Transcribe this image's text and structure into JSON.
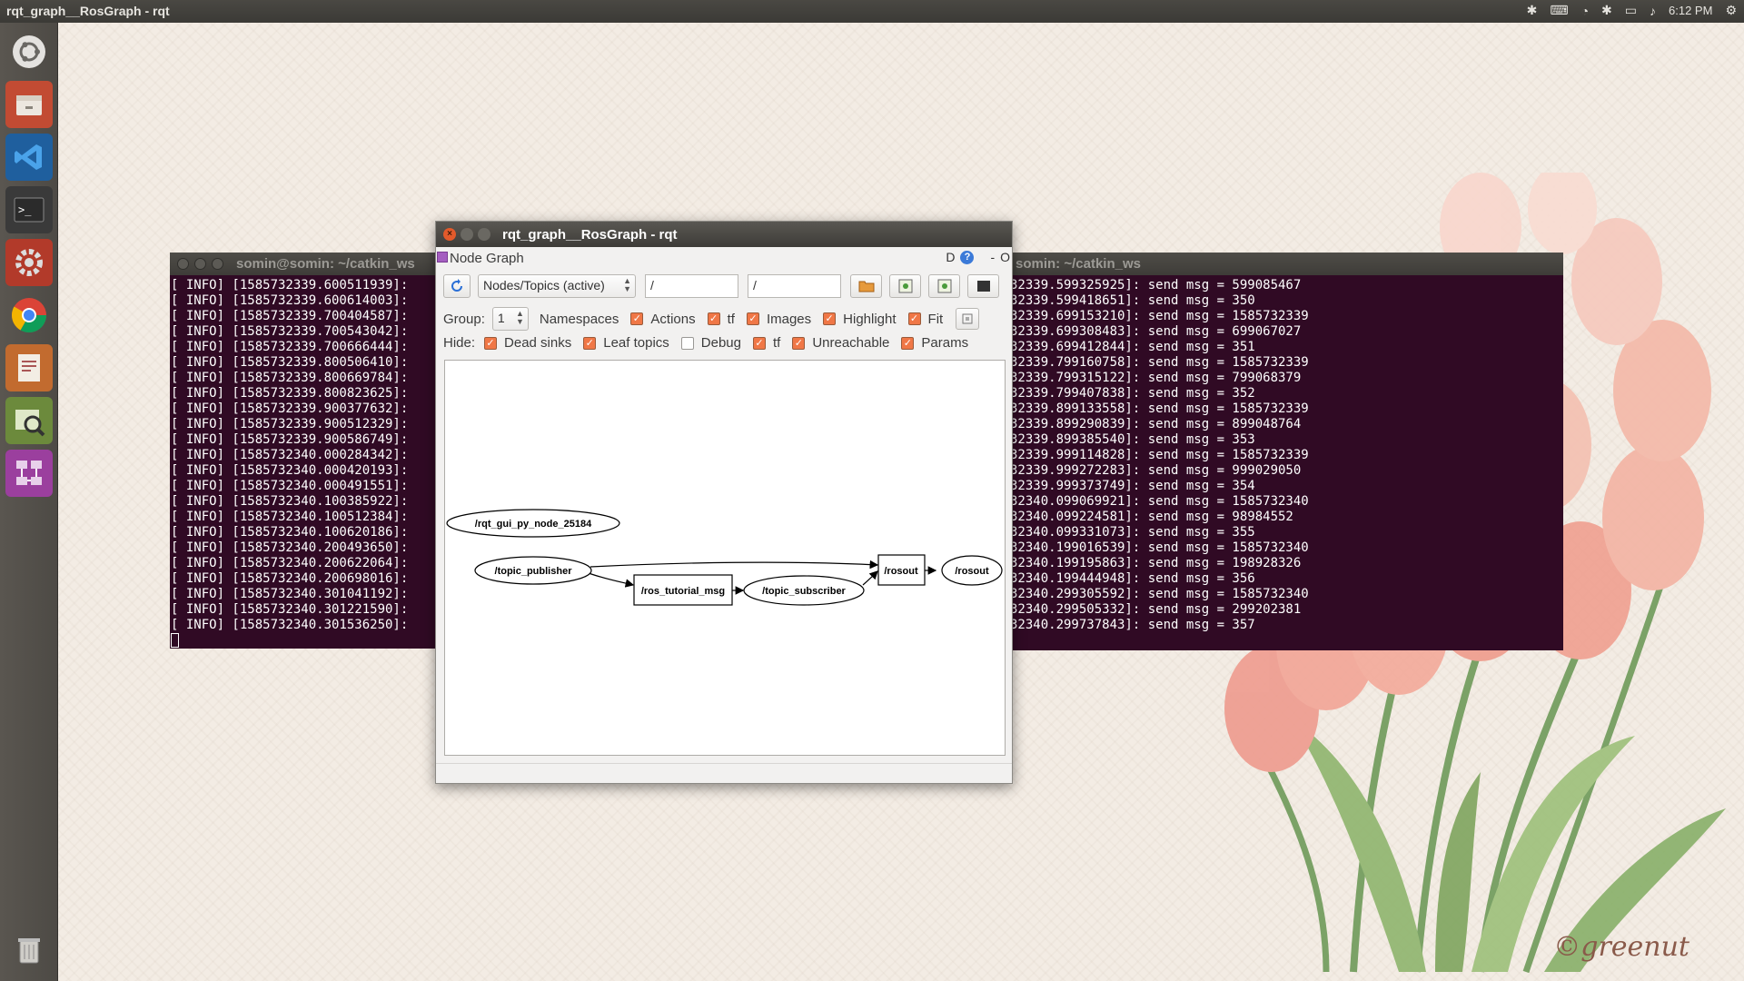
{
  "top_panel": {
    "title": "rqt_graph__RosGraph - rqt",
    "clock": "6:12 PM"
  },
  "launcher": {
    "items": [
      {
        "icon": "ubuntu-dash-icon"
      },
      {
        "icon": "file-manager-icon"
      },
      {
        "icon": "vscode-icon"
      },
      {
        "icon": "terminal-icon"
      },
      {
        "icon": "system-settings-icon"
      },
      {
        "icon": "chrome-icon"
      },
      {
        "icon": "document-viewer-icon"
      },
      {
        "icon": "image-viewer-icon"
      },
      {
        "icon": "rqt-app-icon"
      },
      {
        "icon": "trash-icon"
      }
    ]
  },
  "terminal_left": {
    "title": "somin@somin: ~/catkin_ws",
    "lines": [
      "[ INFO] [1585732339.600511939]: ",
      "[ INFO] [1585732339.600614003]: ",
      "[ INFO] [1585732339.700404587]: ",
      "[ INFO] [1585732339.700543042]: ",
      "[ INFO] [1585732339.700666444]: ",
      "[ INFO] [1585732339.800506410]: ",
      "[ INFO] [1585732339.800669784]: ",
      "[ INFO] [1585732339.800823625]: ",
      "[ INFO] [1585732339.900377632]: ",
      "[ INFO] [1585732339.900512329]: ",
      "[ INFO] [1585732339.900586749]: ",
      "[ INFO] [1585732340.000284342]: ",
      "[ INFO] [1585732340.000420193]: ",
      "[ INFO] [1585732340.000491551]: ",
      "[ INFO] [1585732340.100385922]: ",
      "[ INFO] [1585732340.100512384]: ",
      "[ INFO] [1585732340.100620186]: ",
      "[ INFO] [1585732340.200493650]: ",
      "[ INFO] [1585732340.200622064]: ",
      "[ INFO] [1585732340.200698016]: ",
      "[ INFO] [1585732340.301041192]: ",
      "[ INFO] [1585732340.301221590]: ",
      "[ INFO] [1585732340.301536250]: "
    ]
  },
  "terminal_right": {
    "title": "somin: ~/catkin_ws",
    "lines": [
      "32339.599325925]: send msg = 599085467",
      "32339.599418651]: send msg = 350",
      "32339.699153210]: send msg = 1585732339",
      "32339.699308483]: send msg = 699067027",
      "32339.699412844]: send msg = 351",
      "32339.799160758]: send msg = 1585732339",
      "32339.799315122]: send msg = 799068379",
      "32339.799407838]: send msg = 352",
      "32339.899133558]: send msg = 1585732339",
      "32339.899290839]: send msg = 899048764",
      "32339.899385540]: send msg = 353",
      "32339.999114828]: send msg = 1585732339",
      "32339.999272283]: send msg = 999029050",
      "32339.999373749]: send msg = 354",
      "32340.099069921]: send msg = 1585732340",
      "32340.099224581]: send msg = 98984552",
      "32340.099331073]: send msg = 355",
      "32340.199016539]: send msg = 1585732340",
      "32340.199195863]: send msg = 198928326",
      "32340.199444948]: send msg = 356",
      "32340.299305592]: send msg = 1585732340",
      "32340.299505332]: send msg = 299202381",
      "32340.299737843]: send msg = 357"
    ]
  },
  "rqt": {
    "title": "rqt_graph__RosGraph - rqt",
    "dock_title": "Node Graph",
    "dock_right_d": "D",
    "dock_right_help": "?",
    "dock_right_minus": "-",
    "dock_right_o": "O",
    "graph_type": "Nodes/Topics (active)",
    "filter1": "/",
    "filter2": "/",
    "group_label": "Group:",
    "group_value": "1",
    "row1": [
      {
        "label": "Namespaces",
        "checked": false,
        "hidden_box": true
      },
      {
        "label": "Actions",
        "checked": true
      },
      {
        "label": "tf",
        "checked": true
      },
      {
        "label": "Images",
        "checked": true
      },
      {
        "label": "Highlight",
        "checked": true
      },
      {
        "label": "Fit",
        "checked": true
      }
    ],
    "hide_label": "Hide:",
    "row2": [
      {
        "label": "Dead sinks",
        "checked": true
      },
      {
        "label": "Leaf topics",
        "checked": true
      },
      {
        "label": "Debug",
        "checked": false
      },
      {
        "label": "tf",
        "checked": true
      },
      {
        "label": "Unreachable",
        "checked": true
      },
      {
        "label": "Params",
        "checked": true
      }
    ],
    "graph": {
      "nodes": {
        "gui": "/rqt_gui_py_node_25184",
        "publisher": "/topic_publisher",
        "tutorial_msg": "/ros_tutorial_msg",
        "subscriber": "/topic_subscriber",
        "rosout_topic": "/rosout",
        "rosout_node": "/rosout"
      }
    }
  },
  "wallpaper": {
    "signature": "©greenut"
  }
}
